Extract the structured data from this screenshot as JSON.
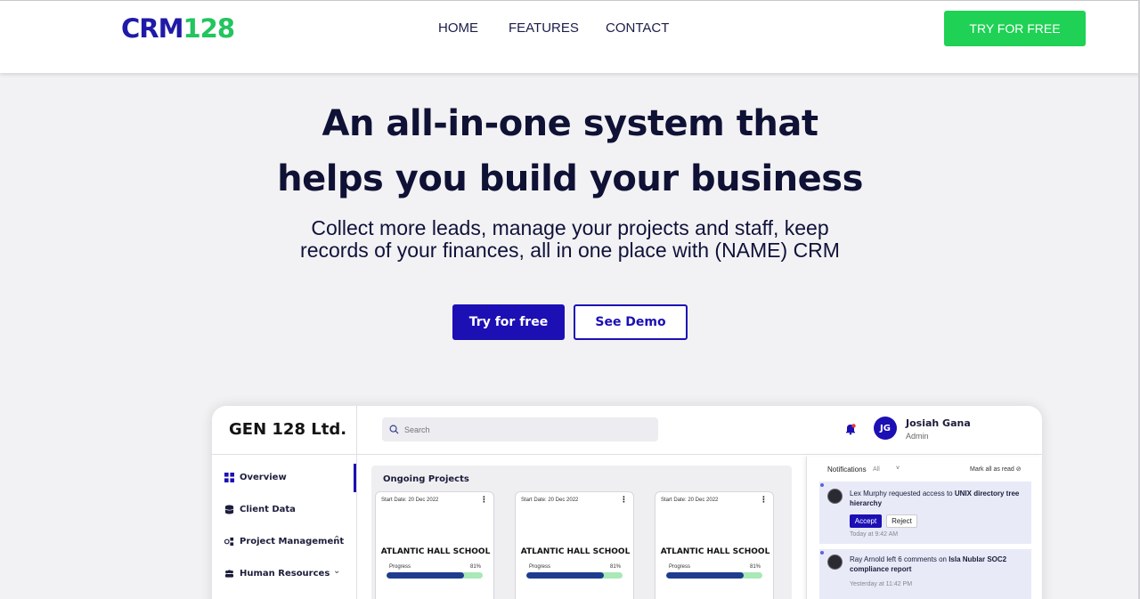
{
  "header": {
    "logo_part1": "CRM",
    "logo_part2": "128",
    "nav": [
      "HOME",
      "FEATURES",
      "CONTACT"
    ],
    "cta_label": "TRY FOR FREE"
  },
  "hero": {
    "title_line1": "An all-in-one system that",
    "title_line2": "helps you build your business",
    "subtitle_line1": "Collect more leads, manage your projects and staff, keep",
    "subtitle_line2": "records of your finances, all in one place with (NAME) CRM",
    "primary_button": "Try for free",
    "secondary_button": "See Demo"
  },
  "dashboard": {
    "brand": "GEN 128 Ltd.",
    "search_placeholder": "Search",
    "user": {
      "initials": "JG",
      "name": "Josiah Gana",
      "role": "Admin"
    },
    "sidebar": [
      {
        "label": "Overview",
        "icon": "grid-icon"
      },
      {
        "label": "Client Data",
        "icon": "database-icon"
      },
      {
        "label": "Project Management",
        "icon": "project-icon",
        "chevron": "up"
      },
      {
        "label": "Human Resources",
        "icon": "people-icon",
        "chevron": "down"
      }
    ],
    "projects": {
      "title": "Ongoing Projects",
      "cards": [
        {
          "start": "Start Date: 20 Dec 2022",
          "name": "ATLANTIC HALL SCHOOL",
          "progress_label": "Progress",
          "progress_text": "81%",
          "progress": 81
        },
        {
          "start": "Start Date: 20 Dec 2022",
          "name": "ATLANTIC HALL SCHOOL",
          "progress_label": "Progress",
          "progress_text": "81%",
          "progress": 81
        },
        {
          "start": "Start Date: 20 Dec 2022",
          "name": "ATLANTIC HALL SCHOOL",
          "progress_label": "Progress",
          "progress_text": "81%",
          "progress": 81
        }
      ]
    },
    "notifications": {
      "title": "Notifications",
      "filter": "All",
      "mark_all": "Mark all as read",
      "items": [
        {
          "user": "Lex Murphy",
          "action": "requested access to",
          "target": "UNIX directory tree hierarchy",
          "accept": "Accept",
          "reject": "Reject",
          "time": "Today at 9:42 AM"
        },
        {
          "user": "Ray Arnold",
          "action": "left 6 comments on",
          "target": "Isla Nublar SOC2 compliance report",
          "time": "Yesterday at 11:42 PM"
        }
      ]
    }
  },
  "colors": {
    "brand_blue": "#1c0fb4",
    "brand_green": "#1fd155",
    "progress_fill": "#1f3c8f",
    "progress_track": "#a9e8b7"
  }
}
